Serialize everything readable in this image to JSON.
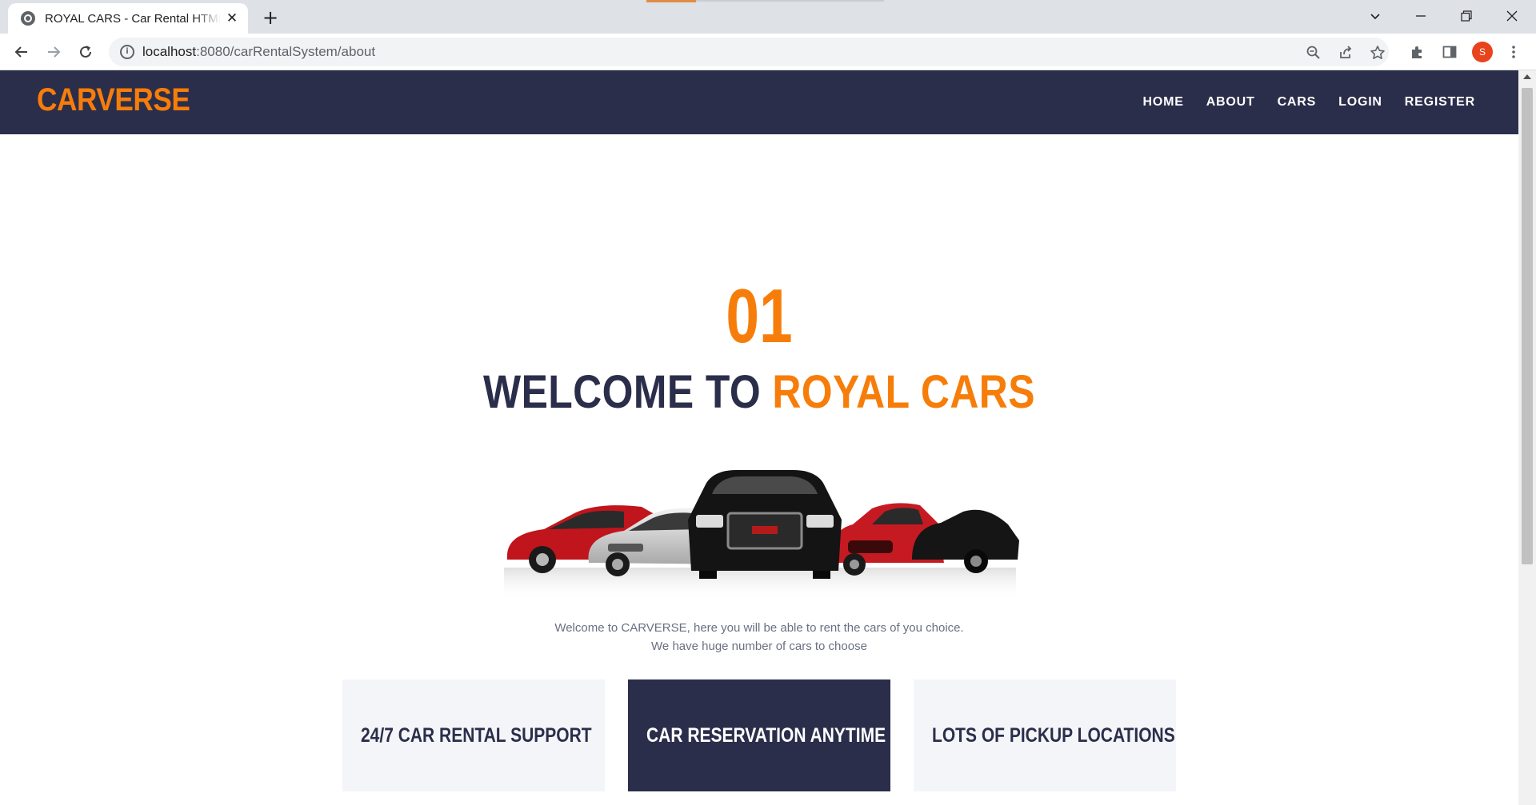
{
  "browser": {
    "tab_title": "ROYAL CARS - Car Rental HTML Template",
    "new_tab_glyph": "+",
    "close_glyph": "✕",
    "url_host": "localhost",
    "url_path": ":8080/carRentalSystem/about",
    "profile_initial": "S"
  },
  "site": {
    "brand": "CARVERSE",
    "nav": [
      "HOME",
      "ABOUT",
      "CARS",
      "LOGIN",
      "REGISTER"
    ],
    "accent_color": "#f77d0a",
    "dark_color": "#2b2e4a"
  },
  "about": {
    "number": "01",
    "welcome_prefix": "WELCOME TO ",
    "welcome_accent": "ROYAL CARS",
    "lead_line1": "Welcome to CARVERSE, here you will be able to rent the cars of you choice.",
    "lead_line2": "We have huge number of cars to choose"
  },
  "features": [
    {
      "label": "24/7 CAR RENTAL SUPPORT"
    },
    {
      "label": "CAR RESERVATION ANYTIME"
    },
    {
      "label": "LOTS OF PICKUP LOCATIONS"
    }
  ]
}
